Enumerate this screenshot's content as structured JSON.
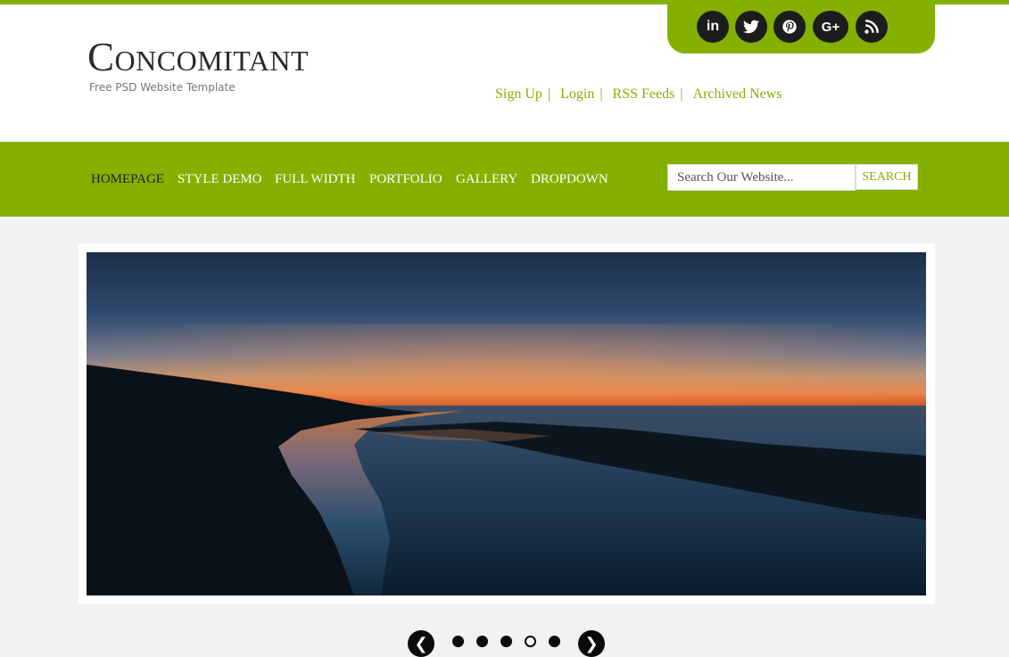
{
  "site": {
    "title": "Concomitant",
    "tagline": "Free PSD Website Template"
  },
  "colors": {
    "accent": "#84b000",
    "dark": "#1d1d1d",
    "background": "#f2f2f2"
  },
  "social": {
    "items": [
      {
        "name": "linkedin-icon",
        "glyph": "in"
      },
      {
        "name": "twitter-icon"
      },
      {
        "name": "pinterest-icon"
      },
      {
        "name": "google-plus-icon",
        "glyph": "G+"
      },
      {
        "name": "rss-icon"
      }
    ]
  },
  "toplinks": {
    "items": [
      {
        "label": "Sign Up"
      },
      {
        "label": "Login"
      },
      {
        "label": "RSS Feeds"
      },
      {
        "label": "Archived News"
      }
    ],
    "separator": "|"
  },
  "nav": {
    "items": [
      {
        "label": "HOMEPAGE",
        "active": true
      },
      {
        "label": "STYLE DEMO"
      },
      {
        "label": "FULL WIDTH"
      },
      {
        "label": "PORTFOLIO"
      },
      {
        "label": "GALLERY"
      },
      {
        "label": "DROPDOWN"
      }
    ]
  },
  "search": {
    "placeholder": "Search Our Website...",
    "button_label": "SEARCH"
  },
  "slider": {
    "image_icon": "sunset-beach-photo",
    "prev_glyph": "❮",
    "next_glyph": "❯",
    "slide_count": 5,
    "active_index": 3
  }
}
